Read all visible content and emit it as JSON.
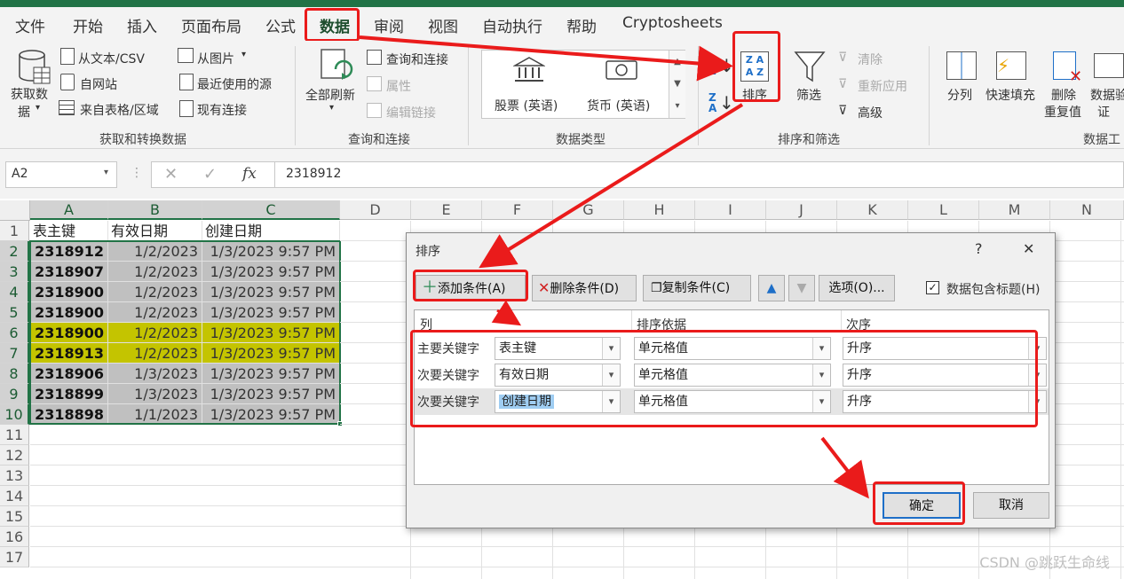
{
  "tabs": [
    "文件",
    "开始",
    "插入",
    "页面布局",
    "公式",
    "数据",
    "审阅",
    "视图",
    "自动执行",
    "帮助",
    "Cryptosheets"
  ],
  "ribbon": {
    "get_data_label_1": "获取数",
    "get_data_label_2": "据",
    "from_text": "从文本/CSV",
    "from_web": "自网站",
    "from_table": "来自表格/区域",
    "from_picture": "从图片",
    "recent_sources": "最近使用的源",
    "existing_conn": "现有连接",
    "group_get": "获取和转换数据",
    "refresh_all": "全部刷新",
    "queries_conn": "查询和连接",
    "properties": "属性",
    "edit_links": "编辑链接",
    "group_queries": "查询和连接",
    "stocks": "股票 (英语)",
    "currency": "货币 (英语)",
    "group_datatypes": "数据类型",
    "sort": "排序",
    "filter": "筛选",
    "clear": "清除",
    "reapply": "重新应用",
    "advanced": "高级",
    "group_sort": "排序和筛选",
    "text_to_cols": "分列",
    "flash_fill": "快速填充",
    "remove_dup_1": "删除",
    "remove_dup_2": "重复值",
    "validation_1": "数据验",
    "validation_2": "证",
    "group_tools": "数据工"
  },
  "formula_bar": {
    "name_box": "A2",
    "fx": "fx",
    "value": "2318912"
  },
  "columns": [
    "A",
    "B",
    "C",
    "D",
    "E",
    "F",
    "G",
    "H",
    "I",
    "J",
    "K",
    "L",
    "M",
    "N"
  ],
  "rows": [
    "1",
    "2",
    "3",
    "4",
    "5",
    "6",
    "7",
    "8",
    "9",
    "10",
    "11",
    "12",
    "13",
    "14",
    "15",
    "16",
    "17"
  ],
  "headers": [
    "表主键",
    "有效日期",
    "创建日期"
  ],
  "table": [
    [
      "2318912",
      "1/2/2023",
      "1/3/2023 9:57 PM"
    ],
    [
      "2318907",
      "1/2/2023",
      "1/3/2023 9:57 PM"
    ],
    [
      "2318900",
      "1/2/2023",
      "1/3/2023 9:57 PM"
    ],
    [
      "2318900",
      "1/2/2023",
      "1/3/2023 9:57 PM"
    ],
    [
      "2318900",
      "1/2/2023",
      "1/3/2023 9:57 PM"
    ],
    [
      "2318913",
      "1/2/2023",
      "1/3/2023 9:57 PM"
    ],
    [
      "2318906",
      "1/3/2023",
      "1/3/2023 9:57 PM"
    ],
    [
      "2318899",
      "1/3/2023",
      "1/3/2023 9:57 PM"
    ],
    [
      "2318898",
      "1/1/2023",
      "1/3/2023 9:57 PM"
    ]
  ],
  "dialog": {
    "title": "排序",
    "help": "?",
    "close": "✕",
    "add_level": "添加条件(A)",
    "delete_level": "删除条件(D)",
    "copy_level": "复制条件(C)",
    "options": "选项(O)...",
    "has_headers": "数据包含标题(H)",
    "col_header": "列",
    "sort_on_header": "排序依据",
    "order_header": "次序",
    "levels": [
      {
        "label": "主要关键字",
        "column": "表主键",
        "sort_on": "单元格值",
        "order": "升序"
      },
      {
        "label": "次要关键字",
        "column": "有效日期",
        "sort_on": "单元格值",
        "order": "升序"
      },
      {
        "label": "次要关键字",
        "column": "创建日期",
        "sort_on": "单元格值",
        "order": "升序"
      }
    ],
    "ok": "确定",
    "cancel": "取消"
  },
  "watermark": "CSDN @跳跃生命线",
  "colors": {
    "excel_green": "#217346",
    "highlight_red": "#ea1b1b",
    "row_yellow": "#c4c400",
    "row_gray": "#c0c0c0"
  }
}
